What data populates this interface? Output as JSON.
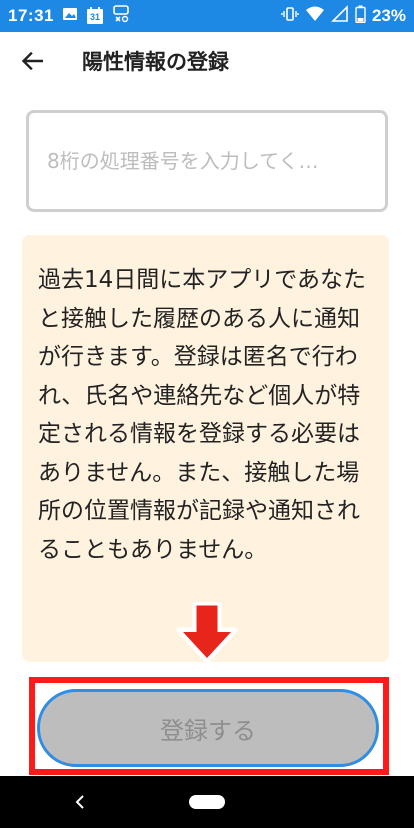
{
  "status_bar": {
    "time": "17:31",
    "calendar_day": "31",
    "battery_text": "23%",
    "icons": [
      "image-icon",
      "calendar-icon",
      "notification-icon",
      "vibrate-icon",
      "wifi-icon",
      "signal-icon",
      "battery-icon"
    ]
  },
  "header": {
    "title": "陽性情報の登録"
  },
  "form": {
    "code_placeholder": "8桁の処理番号を入力してく…",
    "code_value": ""
  },
  "info": {
    "text": "過去14日間に本アプリであなたと接触した履歴のある人に通知が行きます。登録は匿名で行われ、氏名や連絡先など個人が特定される情報を登録する必要はありません。また、接触した場所の位置情報が記録や通知されることもありません。"
  },
  "actions": {
    "register_label": "登録する"
  },
  "annotation": {
    "arrow_color": "#e8251a",
    "frame_color": "#ff1a1a"
  },
  "colors": {
    "status_bar": "#1e88e5",
    "card_background": "#fff3e0",
    "button_disabled": "#bdbdbd",
    "button_border": "#2f8de4"
  }
}
